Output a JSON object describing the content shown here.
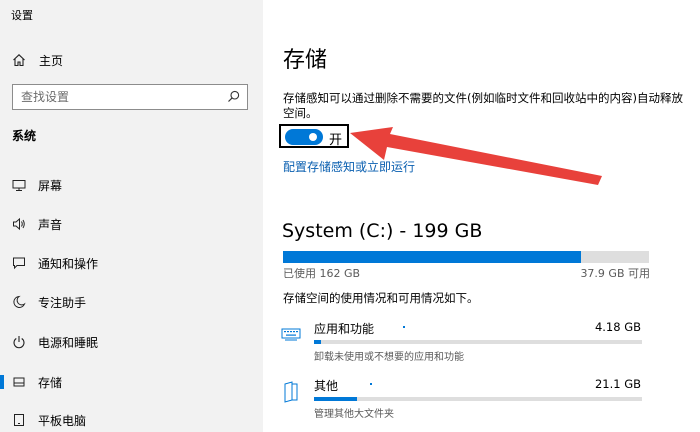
{
  "app_title": "设置",
  "sidebar": {
    "home": "主页",
    "search_placeholder": "查找设置",
    "section": "系统",
    "items": [
      {
        "label": "屏幕",
        "icon": "monitor-icon"
      },
      {
        "label": "声音",
        "icon": "speaker-icon"
      },
      {
        "label": "通知和操作",
        "icon": "message-icon"
      },
      {
        "label": "专注助手",
        "icon": "moon-icon"
      },
      {
        "label": "电源和睡眠",
        "icon": "power-icon"
      },
      {
        "label": "存储",
        "icon": "storage-icon",
        "active": true
      },
      {
        "label": "平板电脑",
        "icon": "tablet-icon"
      }
    ]
  },
  "main": {
    "title": "存储",
    "description": "存储感知可以通过删除不需要的文件(例如临时文件和回收站中的内容)自动释放空间。",
    "toggle": {
      "state": "开",
      "on": true
    },
    "configure_link": "配置存储感知或立即运行",
    "drive": {
      "title": "System (C:) - 199 GB",
      "used": "已使用 162 GB",
      "free": "37.9 GB 可用",
      "used_fraction": 0.814
    },
    "usage_description": "存储空间的使用情况和可用情况如下。",
    "categories": [
      {
        "name": "应用和功能",
        "size": "4.18 GB",
        "subtitle": "卸载未使用或不想要的应用和功能",
        "icon": "keyboard-icon",
        "fraction": 0.021
      },
      {
        "name": "其他",
        "size": "21.1 GB",
        "subtitle": "管理其他大文件夹",
        "icon": "folder-icon",
        "fraction": 0.13
      }
    ]
  },
  "colors": {
    "accent": "#0078d7",
    "arrow": "#e8413b",
    "sidebar_bg": "#f2f2f2"
  }
}
